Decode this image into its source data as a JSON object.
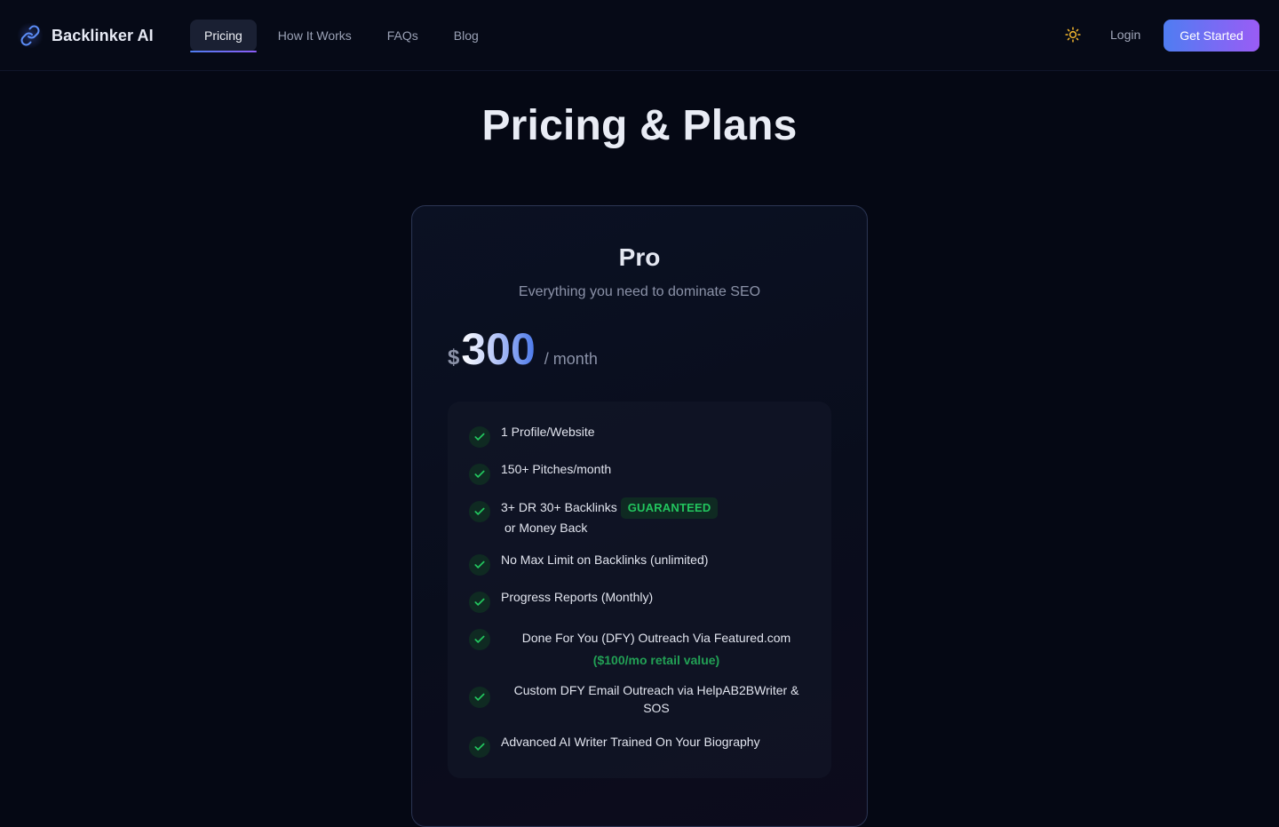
{
  "nav": {
    "brand": "Backlinker AI",
    "links": [
      {
        "label": "Pricing",
        "active": true
      },
      {
        "label": "How It Works",
        "active": false
      },
      {
        "label": "FAQs",
        "active": false
      },
      {
        "label": "Blog",
        "active": false
      }
    ],
    "theme_icon": "sun-icon",
    "login_label": "Login",
    "cta_label": "Get Started"
  },
  "page": {
    "title": "Pricing & Plans"
  },
  "plan": {
    "name": "Pro",
    "tagline": "Everything you need to dominate SEO",
    "currency": "$",
    "price": "300",
    "period": "/ month",
    "features": [
      {
        "text": "1 Profile/Website"
      },
      {
        "text": "150+ Pitches/month"
      },
      {
        "text": "3+ DR 30+ Backlinks",
        "badge": "GUARANTEED",
        "line2": "or Money Back"
      },
      {
        "text": "No Max Limit on Backlinks (unlimited)"
      },
      {
        "text": "Progress Reports (Monthly)"
      },
      {
        "text": "Done For You (DFY) Outreach Via Featured.com",
        "note": "($100/mo retail value)"
      },
      {
        "text": "Custom DFY Email Outreach via HelpAB2BWriter & SOS"
      },
      {
        "text": "Advanced AI Writer Trained On Your Biography"
      }
    ]
  },
  "colors": {
    "background": "#050814",
    "accent_start": "#4f7df2",
    "accent_end": "#9a5cf5",
    "check_green": "#22c55e"
  }
}
